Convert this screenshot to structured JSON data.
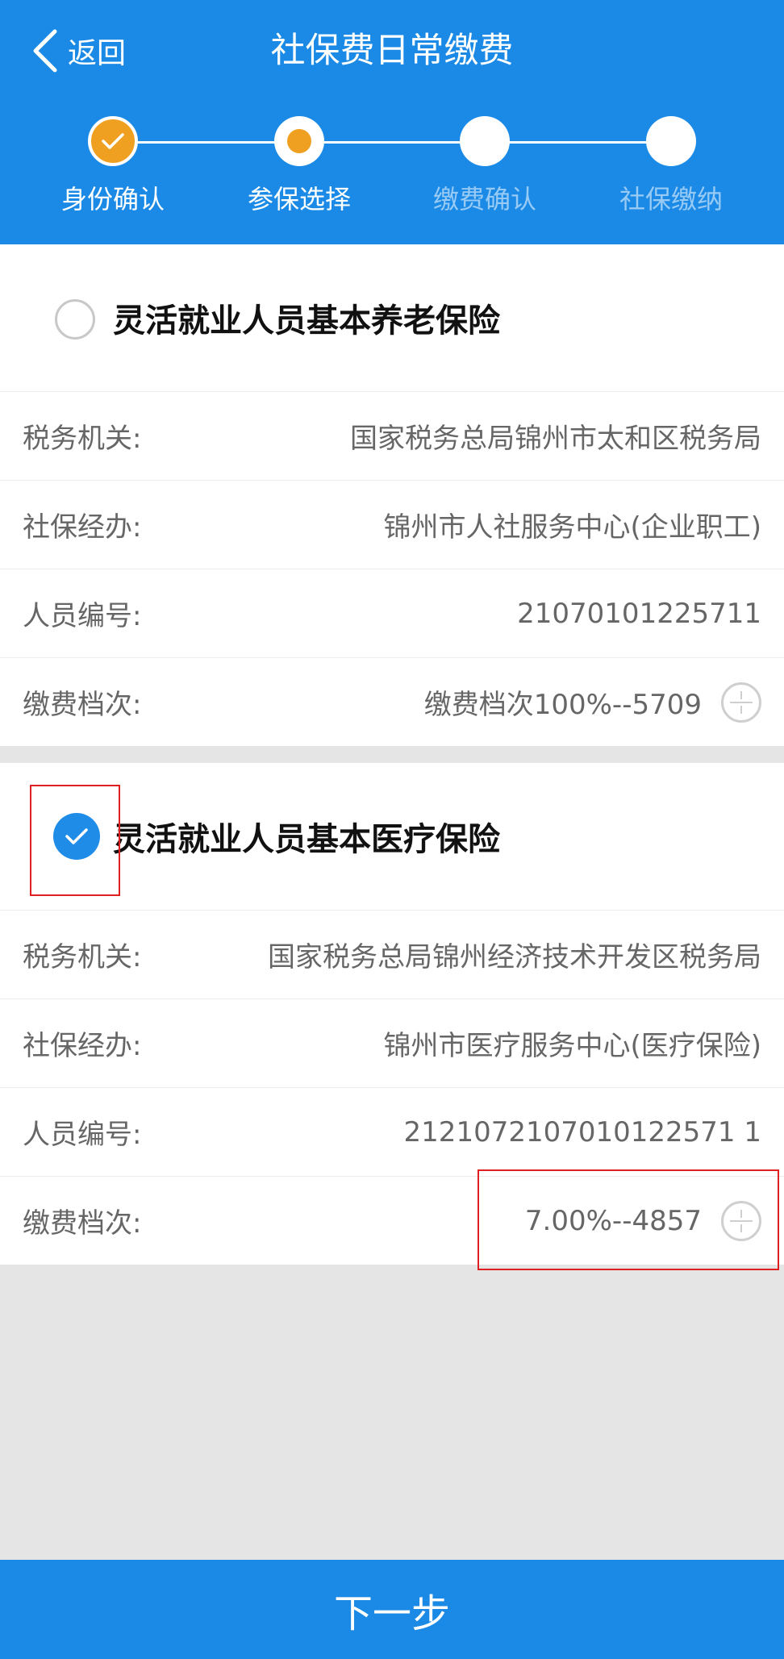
{
  "header": {
    "back_label": "返回",
    "title": "社保费日常缴费"
  },
  "steps": [
    {
      "label": "身份确认",
      "status": "done"
    },
    {
      "label": "参保选择",
      "status": "current"
    },
    {
      "label": "缴费确认",
      "status": "pending"
    },
    {
      "label": "社保缴纳",
      "status": "pending"
    }
  ],
  "cards": [
    {
      "title": "灵活就业人员基本养老保险",
      "selected": false,
      "rows": [
        {
          "label": "税务机关:",
          "value": "国家税务总局锦州市太和区税务局"
        },
        {
          "label": "社保经办:",
          "value": "锦州市人社服务中心(企业职工)"
        },
        {
          "label": "人员编号:",
          "value": "21070101225711"
        },
        {
          "label": "缴费档次:",
          "value": "缴费档次100%--5709"
        }
      ]
    },
    {
      "title": "灵活就业人员基本医疗保险",
      "selected": true,
      "rows": [
        {
          "label": "税务机关:",
          "value": "国家税务总局锦州经济技术开发区税务局"
        },
        {
          "label": "社保经办:",
          "value": "锦州市医疗服务中心(医疗保险)"
        },
        {
          "label": "人员编号:",
          "value": "2121072107010122571 1"
        },
        {
          "label": "缴费档次:",
          "value": "7.00%--4857"
        }
      ]
    }
  ],
  "footer": {
    "next_label": "下一步"
  },
  "colors": {
    "primary": "#1a8ae6",
    "step_done": "#f0a020",
    "annotation": "#e02020"
  }
}
